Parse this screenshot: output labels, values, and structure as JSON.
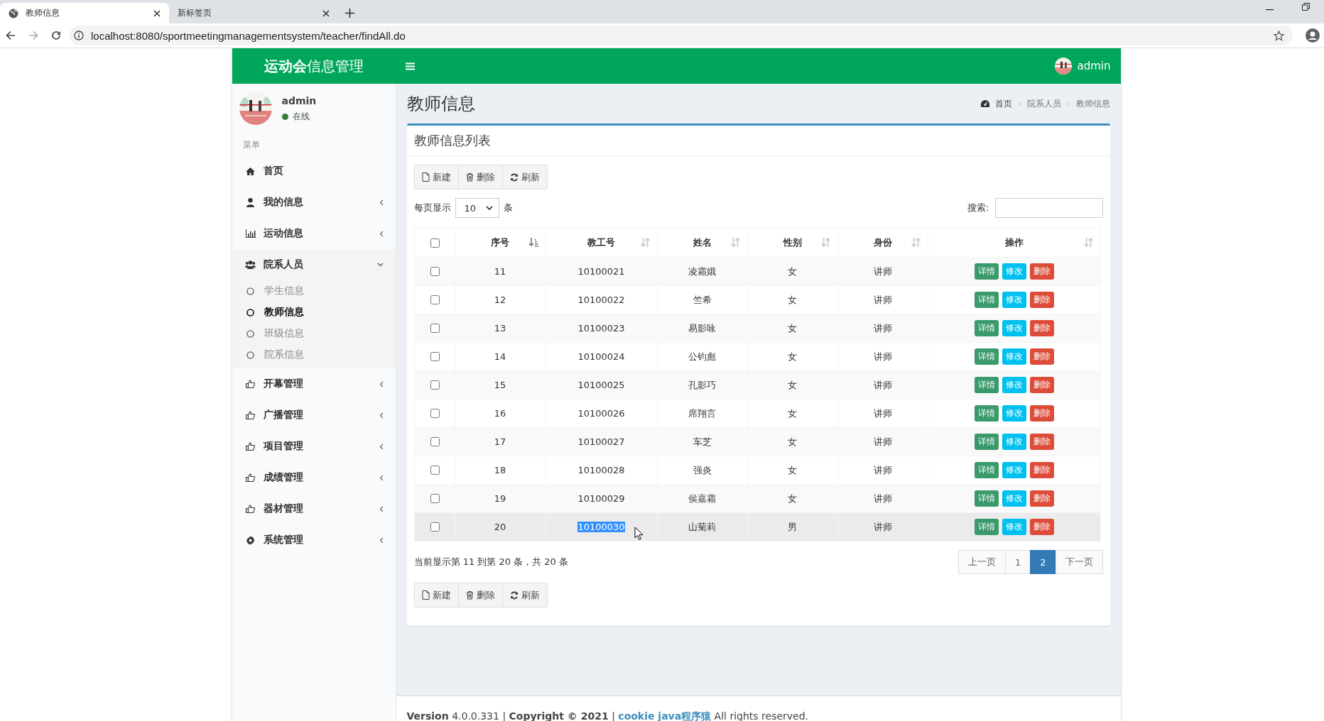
{
  "browser": {
    "tabs": [
      {
        "title": "教师信息",
        "selected": true
      },
      {
        "title": "新标签页",
        "selected": false
      }
    ],
    "url": "localhost:8080/sportmeetingmanagementsystem/teacher/findAll.do"
  },
  "header": {
    "brand_bold": "运动会",
    "brand_rest": "信息管理",
    "user": "admin"
  },
  "sidebar": {
    "user": "admin",
    "status": "在线",
    "menu_label": "菜单",
    "items": [
      {
        "label": "首页",
        "kind": "link"
      },
      {
        "label": "我的信息",
        "kind": "menu",
        "expanded": false
      },
      {
        "label": "运动信息",
        "kind": "menu",
        "expanded": false
      },
      {
        "label": "院系人员",
        "kind": "menu",
        "expanded": true,
        "children": [
          {
            "label": "学生信息",
            "selected": false
          },
          {
            "label": "教师信息",
            "selected": true
          },
          {
            "label": "班级信息",
            "selected": false
          },
          {
            "label": "院系信息",
            "selected": false
          }
        ]
      },
      {
        "label": "开幕管理",
        "kind": "menu",
        "expanded": false
      },
      {
        "label": "广播管理",
        "kind": "menu",
        "expanded": false
      },
      {
        "label": "项目管理",
        "kind": "menu",
        "expanded": false
      },
      {
        "label": "成绩管理",
        "kind": "menu",
        "expanded": false
      },
      {
        "label": "器材管理",
        "kind": "menu",
        "expanded": false
      },
      {
        "label": "系统管理",
        "kind": "menu",
        "expanded": false
      }
    ]
  },
  "content": {
    "title": "教师信息",
    "breadcrumb": [
      "首页",
      "院系人员",
      "教师信息"
    ],
    "box_title": "教师信息列表",
    "toolbar_top": [
      "新建",
      "删除",
      "刷新"
    ],
    "page_length_label": "每页显示",
    "page_length_value": "10",
    "page_length_unit": "条",
    "search_label": "搜索:",
    "select_all_checked": false,
    "columns": [
      {
        "label": "序号",
        "sorted": true
      },
      {
        "label": "教工号",
        "sorted": false
      },
      {
        "label": "姓名",
        "sorted": false
      },
      {
        "label": "性别",
        "sorted": false
      },
      {
        "label": "身份",
        "sorted": false
      },
      {
        "label": "操作",
        "sorted": false
      }
    ],
    "rows": [
      {
        "checked": false,
        "hover": false,
        "id_selected": false,
        "cells": [
          "11",
          "10100021",
          "凌霜娥",
          "女",
          "讲师"
        ],
        "actions": [
          {
            "label": "详情",
            "color": "#3a9a6c"
          },
          {
            "label": "修改",
            "color": "#00c0ef"
          },
          {
            "label": "删除",
            "color": "#dd4b39"
          }
        ]
      },
      {
        "checked": false,
        "hover": false,
        "id_selected": false,
        "cells": [
          "12",
          "10100022",
          "竺希",
          "女",
          "讲师"
        ],
        "actions": [
          {
            "label": "详情",
            "color": "#3a9a6c"
          },
          {
            "label": "修改",
            "color": "#00c0ef"
          },
          {
            "label": "删除",
            "color": "#dd4b39"
          }
        ]
      },
      {
        "checked": false,
        "hover": false,
        "id_selected": false,
        "cells": [
          "13",
          "10100023",
          "易影咏",
          "女",
          "讲师"
        ],
        "actions": [
          {
            "label": "详情",
            "color": "#3a9a6c"
          },
          {
            "label": "修改",
            "color": "#00c0ef"
          },
          {
            "label": "删除",
            "color": "#dd4b39"
          }
        ]
      },
      {
        "checked": false,
        "hover": false,
        "id_selected": false,
        "cells": [
          "14",
          "10100024",
          "公钧彪",
          "女",
          "讲师"
        ],
        "actions": [
          {
            "label": "详情",
            "color": "#3a9a6c"
          },
          {
            "label": "修改",
            "color": "#00c0ef"
          },
          {
            "label": "删除",
            "color": "#dd4b39"
          }
        ]
      },
      {
        "checked": false,
        "hover": false,
        "id_selected": false,
        "cells": [
          "15",
          "10100025",
          "孔影巧",
          "女",
          "讲师"
        ],
        "actions": [
          {
            "label": "详情",
            "color": "#3a9a6c"
          },
          {
            "label": "修改",
            "color": "#00c0ef"
          },
          {
            "label": "删除",
            "color": "#dd4b39"
          }
        ]
      },
      {
        "checked": false,
        "hover": false,
        "id_selected": false,
        "cells": [
          "16",
          "10100026",
          "席翔言",
          "女",
          "讲师"
        ],
        "actions": [
          {
            "label": "详情",
            "color": "#3a9a6c"
          },
          {
            "label": "修改",
            "color": "#00c0ef"
          },
          {
            "label": "删除",
            "color": "#dd4b39"
          }
        ]
      },
      {
        "checked": false,
        "hover": false,
        "id_selected": false,
        "cells": [
          "17",
          "10100027",
          "车芝",
          "女",
          "讲师"
        ],
        "actions": [
          {
            "label": "详情",
            "color": "#3a9a6c"
          },
          {
            "label": "修改",
            "color": "#00c0ef"
          },
          {
            "label": "删除",
            "color": "#dd4b39"
          }
        ]
      },
      {
        "checked": false,
        "hover": false,
        "id_selected": false,
        "cells": [
          "18",
          "10100028",
          "强炎",
          "女",
          "讲师"
        ],
        "actions": [
          {
            "label": "详情",
            "color": "#3a9a6c"
          },
          {
            "label": "修改",
            "color": "#00c0ef"
          },
          {
            "label": "删除",
            "color": "#dd4b39"
          }
        ]
      },
      {
        "checked": false,
        "hover": false,
        "id_selected": false,
        "cells": [
          "19",
          "10100029",
          "侯嘉霜",
          "女",
          "讲师"
        ],
        "actions": [
          {
            "label": "详情",
            "color": "#3a9a6c"
          },
          {
            "label": "修改",
            "color": "#00c0ef"
          },
          {
            "label": "删除",
            "color": "#dd4b39"
          }
        ]
      },
      {
        "checked": false,
        "hover": true,
        "id_selected": true,
        "cells": [
          "20",
          "10100030",
          "山菊莉",
          "男",
          "讲师"
        ],
        "actions": [
          {
            "label": "详情",
            "color": "#3a9a6c"
          },
          {
            "label": "修改",
            "color": "#00c0ef"
          },
          {
            "label": "删除",
            "color": "#dd4b39"
          }
        ]
      }
    ],
    "info": "当前显示第 11 到第 20 条，共 20 条",
    "pages": [
      {
        "label": "上一页",
        "selected": false
      },
      {
        "label": "1",
        "selected": false
      },
      {
        "label": "2",
        "selected": true
      },
      {
        "label": "下一页",
        "selected": false
      }
    ],
    "toolbar_bottom": [
      "新建",
      "删除",
      "刷新"
    ]
  },
  "footer": {
    "text": "**Version** 4.0.0.331 | **Copyright © 2021** |",
    "link": "cookie java程序猿",
    "rest": "All rights reserved."
  }
}
